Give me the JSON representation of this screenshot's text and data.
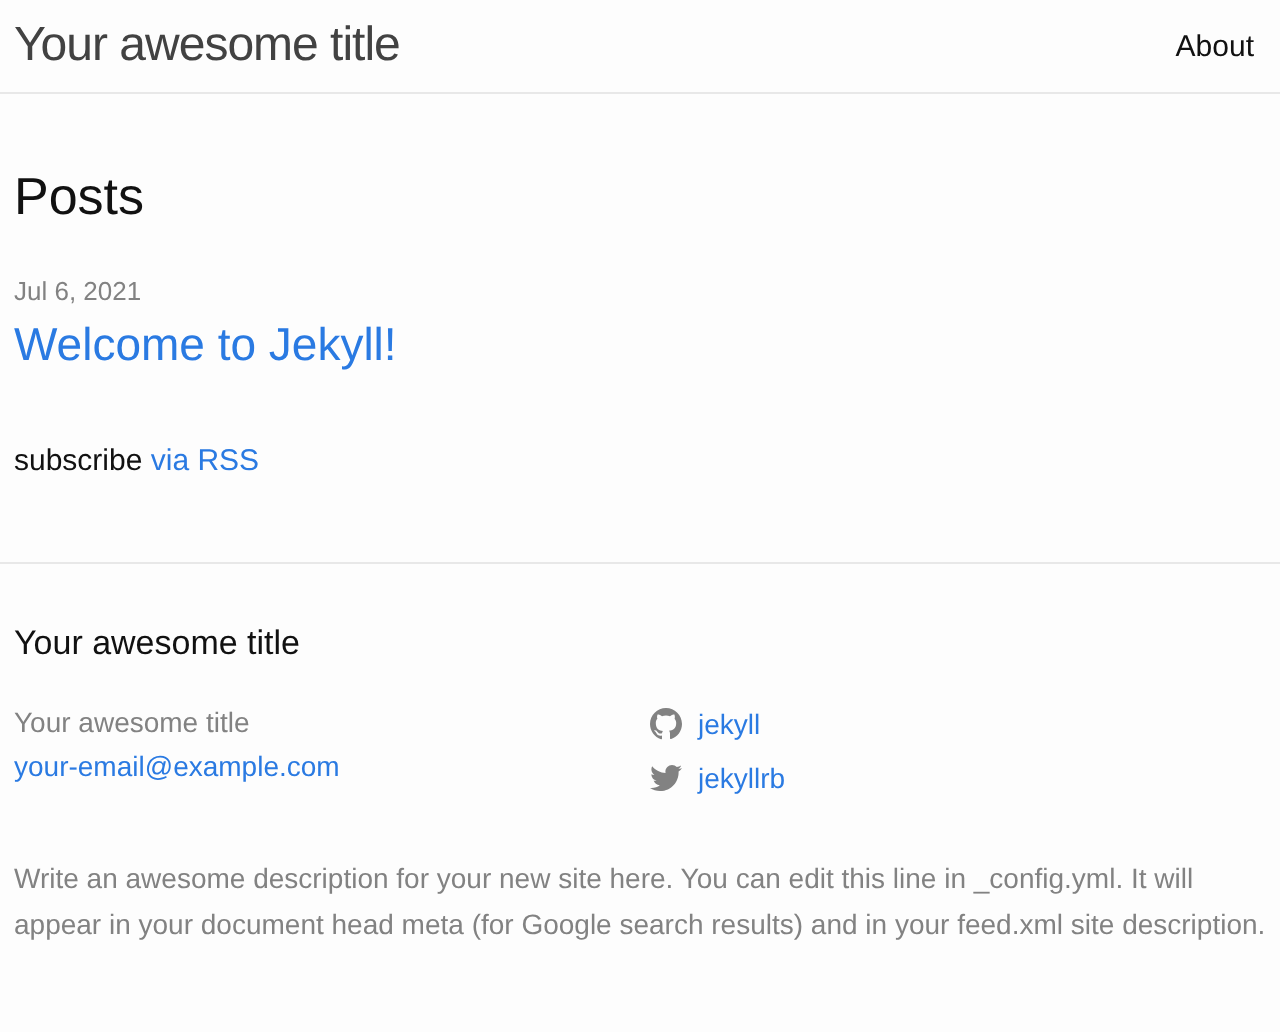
{
  "header": {
    "site_title": "Your awesome title",
    "nav": [
      {
        "label": "About"
      }
    ]
  },
  "main": {
    "heading": "Posts",
    "posts": [
      {
        "date": "Jul 6, 2021",
        "title": "Welcome to Jekyll!"
      }
    ],
    "subscribe": {
      "text": "subscribe",
      "link": "via RSS"
    }
  },
  "footer": {
    "heading": "Your awesome title",
    "contact": [
      "Your awesome title"
    ],
    "email": "your-email@example.com",
    "social": [
      {
        "kind": "github",
        "label": "jekyll"
      },
      {
        "kind": "twitter",
        "label": "jekyllrb"
      }
    ],
    "description": "Write an awesome description for your new site here. You can edit this line in _config.yml. It will appear in your document head meta (for Google search results) and in your feed.xml site description."
  }
}
